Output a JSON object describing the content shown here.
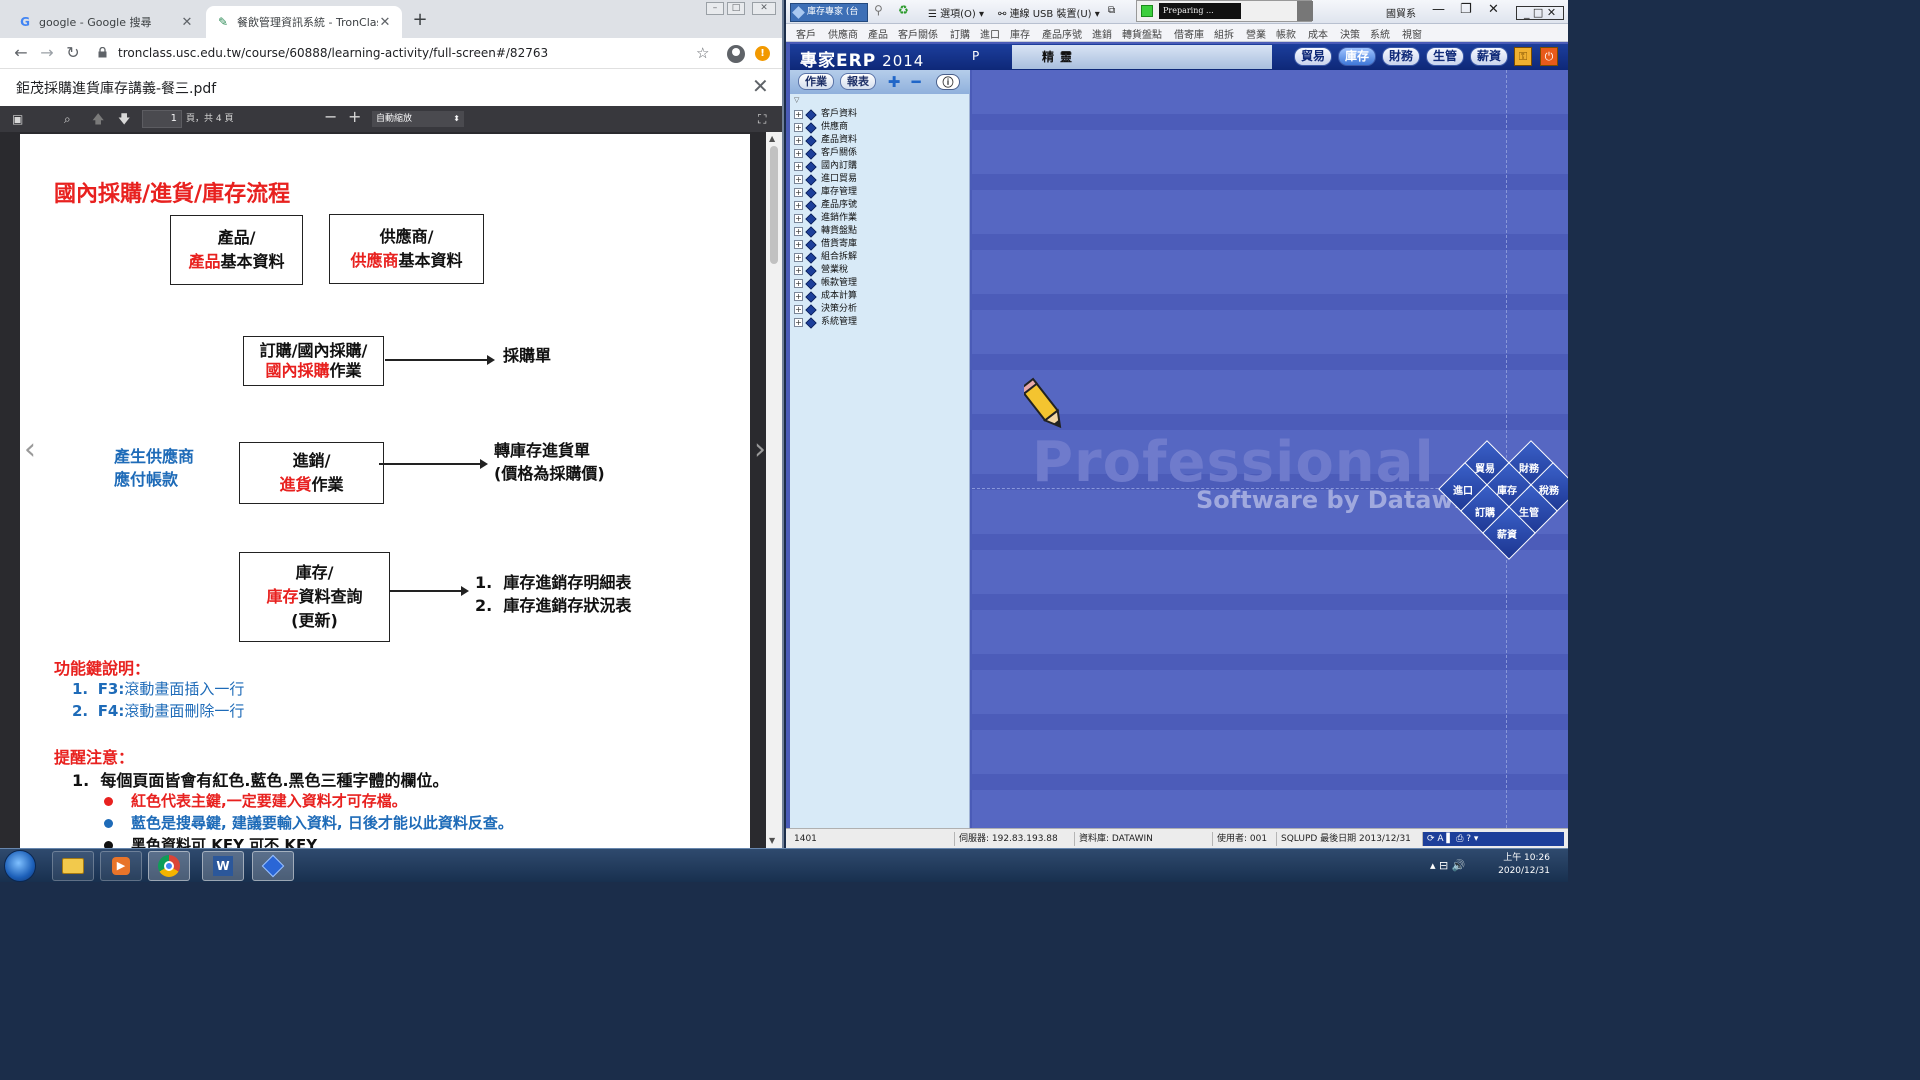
{
  "chrome": {
    "tabs": [
      {
        "label": "google - Google 搜尋"
      },
      {
        "label": "餐飲管理資訊系統 - TronClass"
      }
    ],
    "url": "tronclass.usc.edu.tw/course/60888/learning-activity/full-screen#/82763",
    "pdf_title": "鉅茂採購進貨庫存講義-餐三.pdf",
    "pdf_toolbar": {
      "page_current": "1",
      "page_count": "頁，共 4 頁",
      "zoom": "自動縮放"
    }
  },
  "doc": {
    "title": "國內採購/進貨/庫存流程",
    "box_product": {
      "line1": "產品/",
      "red": "產品",
      "rest": "基本資料"
    },
    "box_vendor": {
      "line1": "供應商/",
      "red": "供應商",
      "rest": "基本資料"
    },
    "box_order": {
      "line1": "訂購/國內採購/",
      "red": "國內採購",
      "rest": "作業"
    },
    "order_output": "採購單",
    "box_purchase": {
      "line1": "進銷/",
      "red": "進貨",
      "rest": "作業"
    },
    "purchase_left": [
      "產生供應商",
      "應付帳款"
    ],
    "purchase_output": [
      "轉庫存進貨單",
      "(價格為採購價)"
    ],
    "box_stock": {
      "line1": "庫存/",
      "red": "庫存",
      "rest": "資料查詢",
      "line3": "(更新)"
    },
    "stock_outputs": [
      {
        "num": "1.",
        "text": "庫存進銷存明細表"
      },
      {
        "num": "2.",
        "text": "庫存進銷存狀況表"
      }
    ],
    "fkeys_title": "功能鍵說明：",
    "fkeys": [
      {
        "num": "1.",
        "key": "F3:",
        "text": "滾動畫面插入一行"
      },
      {
        "num": "2.",
        "key": "F4:",
        "text": "滾動畫面刪除一行"
      }
    ],
    "notes_title": "提醒注意：",
    "note1": {
      "num": "1.",
      "text": "每個頁面皆會有紅色.藍色.黑色三種字體的欄位。"
    },
    "bullets": [
      {
        "text": "紅色代表主鍵,一定要建入資料才可存檔。",
        "color": "#e8211f"
      },
      {
        "text": "藍色是搜尋鍵, 建議要輸入資料, 日後才能以此資料反查。",
        "color": "#1e6bb8"
      },
      {
        "text": "黑色資料可 KEY 可不 KEY",
        "color": "#111111"
      }
    ]
  },
  "erp": {
    "app_tab": "庫存專家 (台",
    "menu_items": [
      "客戶",
      "供應商",
      "產品",
      "客戶關係",
      "訂購",
      "進口",
      "庫存",
      "產品序號",
      "進銷",
      "轉貨盤點",
      "借寄庫",
      "組拆",
      "營業",
      "帳款",
      "成本",
      "決策",
      "系統",
      "視窗"
    ],
    "title_items": [
      "選項(O)",
      "連線 USB 裝置(U)",
      "國貿系"
    ],
    "preparing": "Preparing ...",
    "logo": "專家ERP",
    "logo_year": "2014",
    "p_label": "P",
    "jing": "精靈",
    "header_buttons": [
      "貿易",
      "庫存",
      "財務",
      "生管",
      "薪資"
    ],
    "side_buttons": [
      "作業",
      "報表"
    ],
    "tree": [
      "客戶資料",
      "供應商",
      "產品資料",
      "客戶關係",
      "國內訂購",
      "進口貿易",
      "庫存管理",
      "產品序號",
      "進銷作業",
      "轉貨盤點",
      "借貨寄庫",
      "組合拆解",
      "營業稅",
      "帳款管理",
      "成本計算",
      "決策分析",
      "系統管理"
    ],
    "pro_word": "Professional",
    "pro_sub": "Software by Datawin",
    "diamond_labels": [
      "貿易",
      "財務",
      "進口",
      "庫存",
      "稅務",
      "訂購",
      "生管",
      "薪資"
    ],
    "status": {
      "code": "1401",
      "server": "伺服器: 192.83.193.88",
      "db": "資料庫: DATAWIN",
      "user": "使用者: 001",
      "sqlupd": "SQLUPD 最後日期 2013/12/31"
    }
  },
  "taskbar": {
    "time": "上午 10:26",
    "date": "2020/12/31"
  },
  "colors": {
    "doc_red": "#e8211f",
    "doc_blue": "#1e6bb8",
    "erp_header": "#0e2878",
    "erp_bg": "#5667c2"
  }
}
